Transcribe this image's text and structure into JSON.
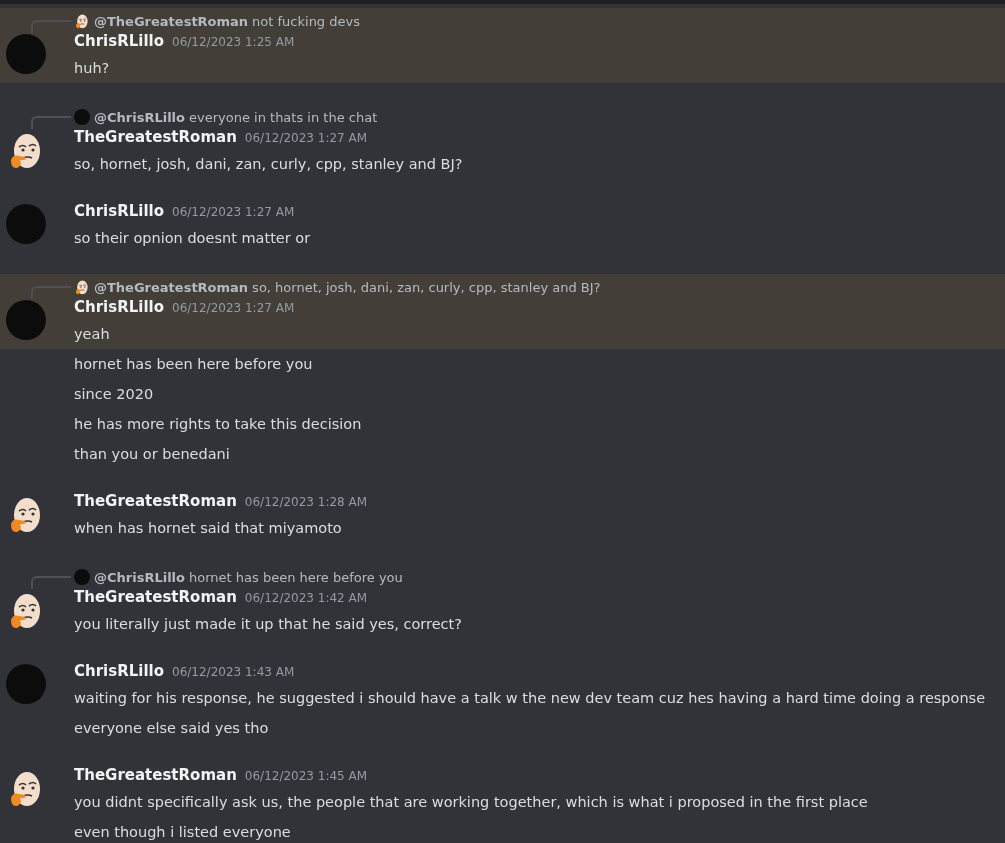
{
  "messages": [
    {
      "highlighted": true,
      "kind": "photo",
      "reply": {
        "kind": "egg",
        "author": "@TheGreatestRoman",
        "text": "not fucking devs"
      },
      "author": "ChrisRLillo",
      "timestamp": "06/12/2023 1:25 AM",
      "lines": [
        "huh?"
      ]
    },
    {
      "highlighted": false,
      "kind": "egg",
      "reply": {
        "kind": "photo",
        "author": "@ChrisRLillo",
        "text": "everyone in thats in the chat"
      },
      "author": "TheGreatestRoman",
      "timestamp": "06/12/2023 1:27 AM",
      "lines": [
        "so, hornet, josh, dani, zan, curly, cpp, stanley and BJ?"
      ]
    },
    {
      "highlighted": false,
      "kind": "photo",
      "author": "ChrisRLillo",
      "timestamp": "06/12/2023 1:27 AM",
      "lines": [
        "so their opnion doesnt matter or"
      ]
    },
    {
      "highlighted": true,
      "kind": "photo",
      "reply": {
        "kind": "egg",
        "author": "@TheGreatestRoman",
        "text": "so, hornet, josh, dani, zan, curly, cpp, stanley and BJ?"
      },
      "author": "ChrisRLillo",
      "timestamp": "06/12/2023 1:27 AM",
      "lines": [
        "yeah"
      ],
      "followups": [
        "hornet has been here before you",
        "since 2020",
        "he has more rights to take this decision",
        "than you or benedani"
      ]
    },
    {
      "highlighted": false,
      "kind": "egg",
      "author": "TheGreatestRoman",
      "timestamp": "06/12/2023 1:28 AM",
      "lines": [
        "when has hornet said that miyamoto"
      ]
    },
    {
      "highlighted": false,
      "kind": "egg",
      "reply": {
        "kind": "photo",
        "author": "@ChrisRLillo",
        "text": "hornet has been here before you"
      },
      "author": "TheGreatestRoman",
      "timestamp": "06/12/2023 1:42 AM",
      "lines": [
        "you literally just made it up that he said yes, correct?"
      ]
    },
    {
      "highlighted": false,
      "kind": "photo",
      "author": "ChrisRLillo",
      "timestamp": "06/12/2023 1:43 AM",
      "lines": [
        "waiting for his response, he suggested i should have a talk w the new dev team cuz hes having a hard time doing a response"
      ],
      "followups": [
        "everyone else said yes tho"
      ]
    },
    {
      "highlighted": false,
      "kind": "egg",
      "author": "TheGreatestRoman",
      "timestamp": "06/12/2023 1:45 AM",
      "lines": [
        "you didnt specifically ask us, the people that are working together, which is what i proposed in the first place"
      ],
      "followups": [
        "even though i listed everyone"
      ]
    }
  ]
}
